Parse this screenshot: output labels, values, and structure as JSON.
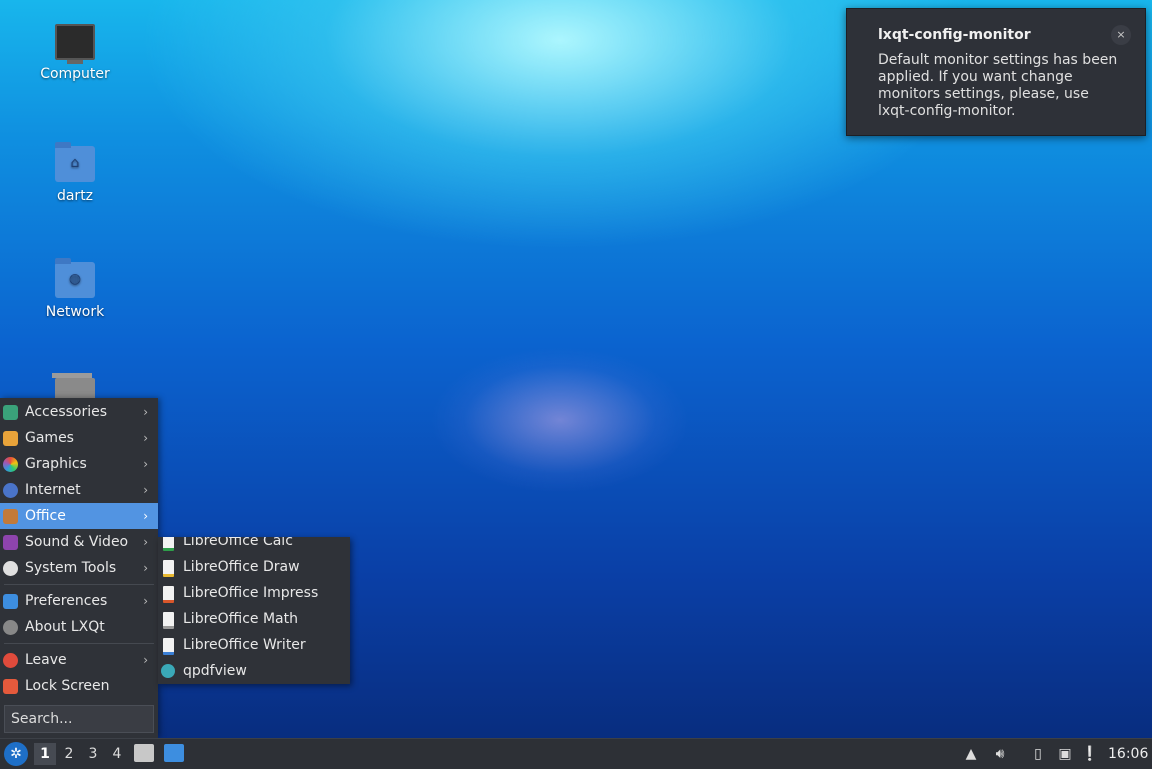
{
  "desktop": {
    "icons": [
      {
        "label": "Computer",
        "icon": "computer-icon"
      },
      {
        "label": "dartz",
        "icon": "home-folder-icon"
      },
      {
        "label": "Network",
        "icon": "network-folder-icon"
      },
      {
        "label": "",
        "icon": "trash-icon"
      }
    ]
  },
  "notification": {
    "title": "lxqt-config-monitor",
    "body": "Default monitor settings has been applied. If you want change monitors settings, please, use lxqt-config-monitor.",
    "close_glyph": "×"
  },
  "menu": {
    "items": [
      {
        "label": "Accessories",
        "has_submenu": true
      },
      {
        "label": "Games",
        "has_submenu": true
      },
      {
        "label": "Graphics",
        "has_submenu": true
      },
      {
        "label": "Internet",
        "has_submenu": true
      },
      {
        "label": "Office",
        "has_submenu": true,
        "active": true
      },
      {
        "label": "Sound & Video",
        "has_submenu": true
      },
      {
        "label": "System Tools",
        "has_submenu": true
      },
      {
        "label": "Preferences",
        "has_submenu": true
      },
      {
        "label": "About LXQt",
        "has_submenu": false
      },
      {
        "label": "Leave",
        "has_submenu": true
      },
      {
        "label": "Lock Screen",
        "has_submenu": false
      }
    ],
    "search_placeholder": "Search...",
    "arrow_glyph": "›"
  },
  "office_submenu": {
    "items": [
      {
        "label": "LibreOffice Calc"
      },
      {
        "label": "LibreOffice Draw"
      },
      {
        "label": "LibreOffice Impress"
      },
      {
        "label": "LibreOffice Math"
      },
      {
        "label": "LibreOffice Writer"
      },
      {
        "label": "qpdfview"
      }
    ]
  },
  "taskbar": {
    "desktops": [
      "1",
      "2",
      "3",
      "4"
    ],
    "active_desktop": "1",
    "clock": "16:06"
  },
  "colors": {
    "accent": "#5294e2",
    "panel": "#2d3036",
    "menu_bg": "#2f3238"
  }
}
